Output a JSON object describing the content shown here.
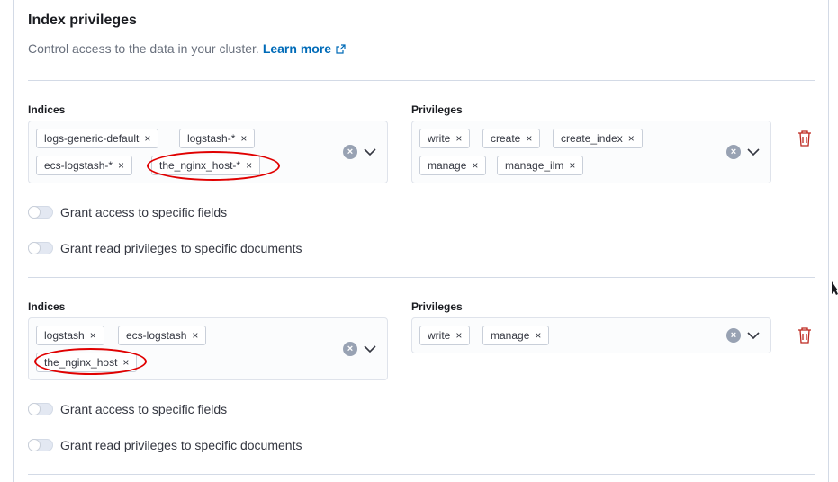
{
  "section": {
    "title": "Index privileges",
    "description": "Control access to the data in your cluster.",
    "learn_more": "Learn more"
  },
  "rows": [
    {
      "indices_label": "Indices",
      "privileges_label": "Privileges",
      "indices": [
        "logs-generic-default",
        "logstash-*",
        "ecs-logstash-*",
        "the_nginx_host-*"
      ],
      "privileges": [
        "write",
        "create",
        "create_index",
        "manage",
        "manage_ilm"
      ],
      "grant_fields": "Grant access to specific fields",
      "grant_documents": "Grant read privileges to specific documents"
    },
    {
      "indices_label": "Indices",
      "privileges_label": "Privileges",
      "indices": [
        "logstash",
        "ecs-logstash",
        "the_nginx_host"
      ],
      "privileges": [
        "write",
        "manage"
      ],
      "grant_fields": "Grant access to specific fields",
      "grant_documents": "Grant read privileges to specific documents"
    }
  ],
  "icons": {
    "remove": "×",
    "clear": "×",
    "colors": {
      "link": "#006bb8",
      "danger": "#bd271e",
      "highlight": "#e00000"
    }
  }
}
